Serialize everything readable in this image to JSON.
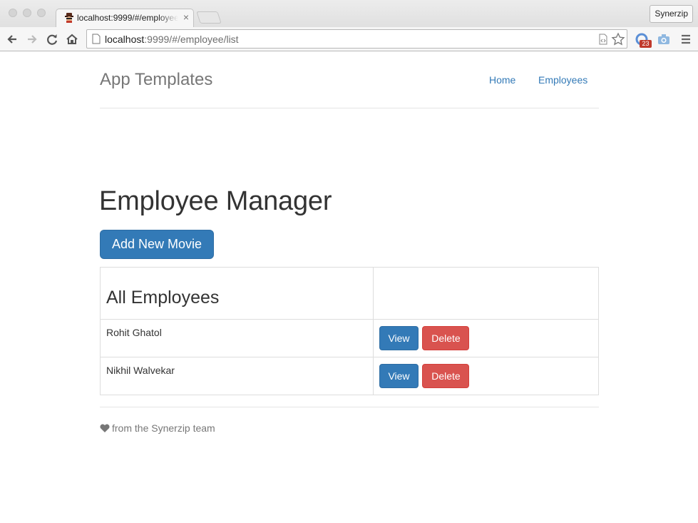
{
  "browser": {
    "tab_title": "localhost:9999/#/employee",
    "tab_close": "×",
    "profile_name": "Synerzip",
    "url_host": "localhost",
    "url_rest": ":9999/#/employee/list",
    "extension_badge": "23"
  },
  "nav": {
    "brand": "App Templates",
    "links": [
      "Home",
      "Employees"
    ]
  },
  "main": {
    "heading": "Employee Manager",
    "add_button": "Add New Movie",
    "table": {
      "title": "All Employees",
      "rows": [
        {
          "name": "Rohit Ghatol",
          "view": "View",
          "delete": "Delete"
        },
        {
          "name": "Nikhil Walvekar",
          "view": "View",
          "delete": "Delete"
        }
      ]
    }
  },
  "footer": {
    "text": "from the Synerzip team",
    "icon": "heart-icon"
  },
  "colors": {
    "primary": "#337ab7",
    "danger": "#d9534f",
    "muted": "#777777"
  }
}
